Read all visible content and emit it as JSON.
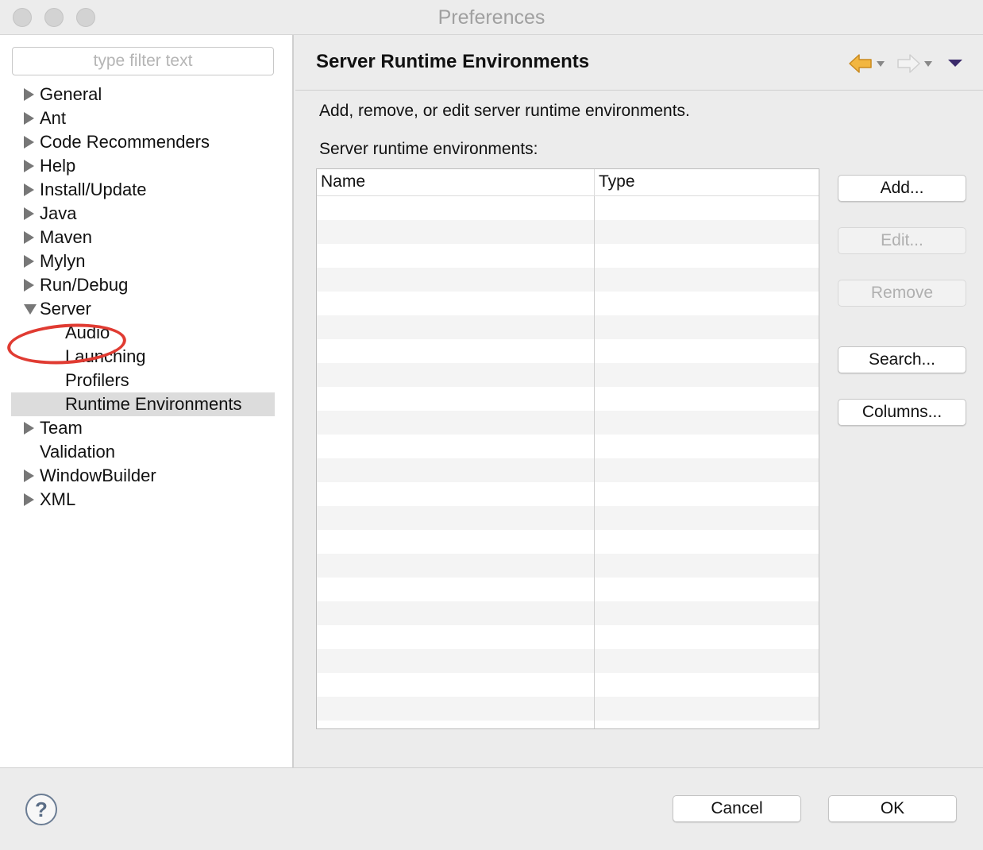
{
  "window": {
    "title": "Preferences"
  },
  "filter": {
    "placeholder": "type filter text",
    "value": ""
  },
  "tree": [
    {
      "label": "General",
      "expander": "closed",
      "level": 0
    },
    {
      "label": "Ant",
      "expander": "closed",
      "level": 0
    },
    {
      "label": "Code Recommenders",
      "expander": "closed",
      "level": 0
    },
    {
      "label": "Help",
      "expander": "closed",
      "level": 0
    },
    {
      "label": "Install/Update",
      "expander": "closed",
      "level": 0
    },
    {
      "label": "Java",
      "expander": "closed",
      "level": 0
    },
    {
      "label": "Maven",
      "expander": "closed",
      "level": 0
    },
    {
      "label": "Mylyn",
      "expander": "closed",
      "level": 0
    },
    {
      "label": "Run/Debug",
      "expander": "closed",
      "level": 0
    },
    {
      "label": "Server",
      "expander": "open",
      "level": 0
    },
    {
      "label": "Audio",
      "expander": "none",
      "level": 1
    },
    {
      "label": "Launching",
      "expander": "none",
      "level": 1
    },
    {
      "label": "Profilers",
      "expander": "none",
      "level": 1
    },
    {
      "label": "Runtime Environments",
      "expander": "none",
      "level": 1,
      "selected": true
    },
    {
      "label": "Team",
      "expander": "closed",
      "level": 0
    },
    {
      "label": "Validation",
      "expander": "none",
      "level": 0
    },
    {
      "label": "WindowBuilder",
      "expander": "closed",
      "level": 0
    },
    {
      "label": "XML",
      "expander": "closed",
      "level": 0
    }
  ],
  "page": {
    "title": "Server Runtime Environments",
    "description": "Add, remove, or edit server runtime environments.",
    "table_label": "Server runtime environments:",
    "columns": [
      "Name",
      "Type"
    ],
    "rows": []
  },
  "buttons": {
    "add": "Add...",
    "edit": "Edit...",
    "remove": "Remove",
    "search": "Search...",
    "columns": "Columns..."
  },
  "footer": {
    "help": "?",
    "cancel": "Cancel",
    "ok": "OK"
  },
  "icons": {
    "back": "arrow-left-icon",
    "forward": "arrow-right-icon",
    "menu": "view-menu-icon"
  },
  "colors": {
    "back_arrow": "#f2b640",
    "forward_arrow": "#d0d0d0",
    "menu_triangle": "#3b2a6b",
    "annotation": "#e03b32"
  }
}
